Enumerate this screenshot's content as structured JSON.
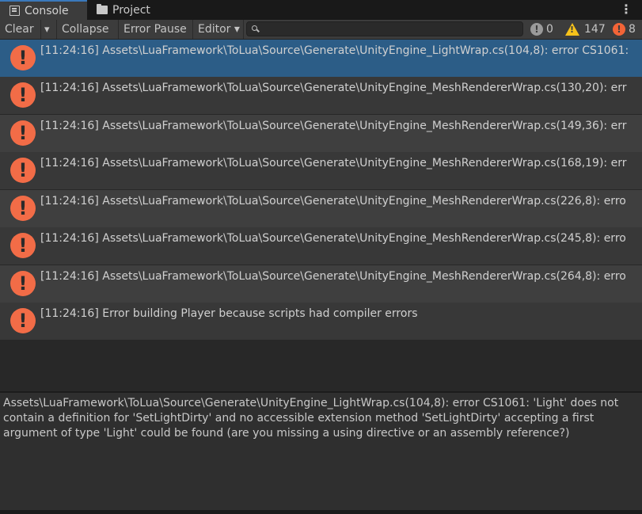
{
  "tabs": {
    "console": "Console",
    "project": "Project",
    "menu": "⋮"
  },
  "toolbar": {
    "clear": "Clear",
    "clear_dropdown": "▾",
    "collapse": "Collapse",
    "error_pause": "Error Pause",
    "editor": "Editor ▾",
    "search_value": "",
    "info_count": "0",
    "warning_count": "147",
    "error_count": "8"
  },
  "logs": [
    {
      "text": "[11:24:16] Assets\\LuaFramework\\ToLua\\Source\\Generate\\UnityEngine_LightWrap.cs(104,8): error CS1061:"
    },
    {
      "text": "[11:24:16] Assets\\LuaFramework\\ToLua\\Source\\Generate\\UnityEngine_MeshRendererWrap.cs(130,20): err"
    },
    {
      "text": "[11:24:16] Assets\\LuaFramework\\ToLua\\Source\\Generate\\UnityEngine_MeshRendererWrap.cs(149,36): err"
    },
    {
      "text": "[11:24:16] Assets\\LuaFramework\\ToLua\\Source\\Generate\\UnityEngine_MeshRendererWrap.cs(168,19): err"
    },
    {
      "text": "[11:24:16] Assets\\LuaFramework\\ToLua\\Source\\Generate\\UnityEngine_MeshRendererWrap.cs(226,8): erro"
    },
    {
      "text": "[11:24:16] Assets\\LuaFramework\\ToLua\\Source\\Generate\\UnityEngine_MeshRendererWrap.cs(245,8): erro"
    },
    {
      "text": "[11:24:16] Assets\\LuaFramework\\ToLua\\Source\\Generate\\UnityEngine_MeshRendererWrap.cs(264,8): erro"
    },
    {
      "text": "[11:24:16] Error building Player because scripts had compiler errors"
    }
  ],
  "detail": {
    "text": "Assets\\LuaFramework\\ToLua\\Source\\Generate\\UnityEngine_LightWrap.cs(104,8): error CS1061: 'Light' does not contain a definition for 'SetLightDirty' and no accessible extension method 'SetLightDirty' accepting a first argument of type 'Light' could be found (are you missing a using directive or an assembly reference?)"
  },
  "colors": {
    "selected_row": "#2c5d87",
    "error_icon": "#f26c47",
    "warning_icon": "#f7c21a",
    "tab_accent": "#3a79bb"
  }
}
